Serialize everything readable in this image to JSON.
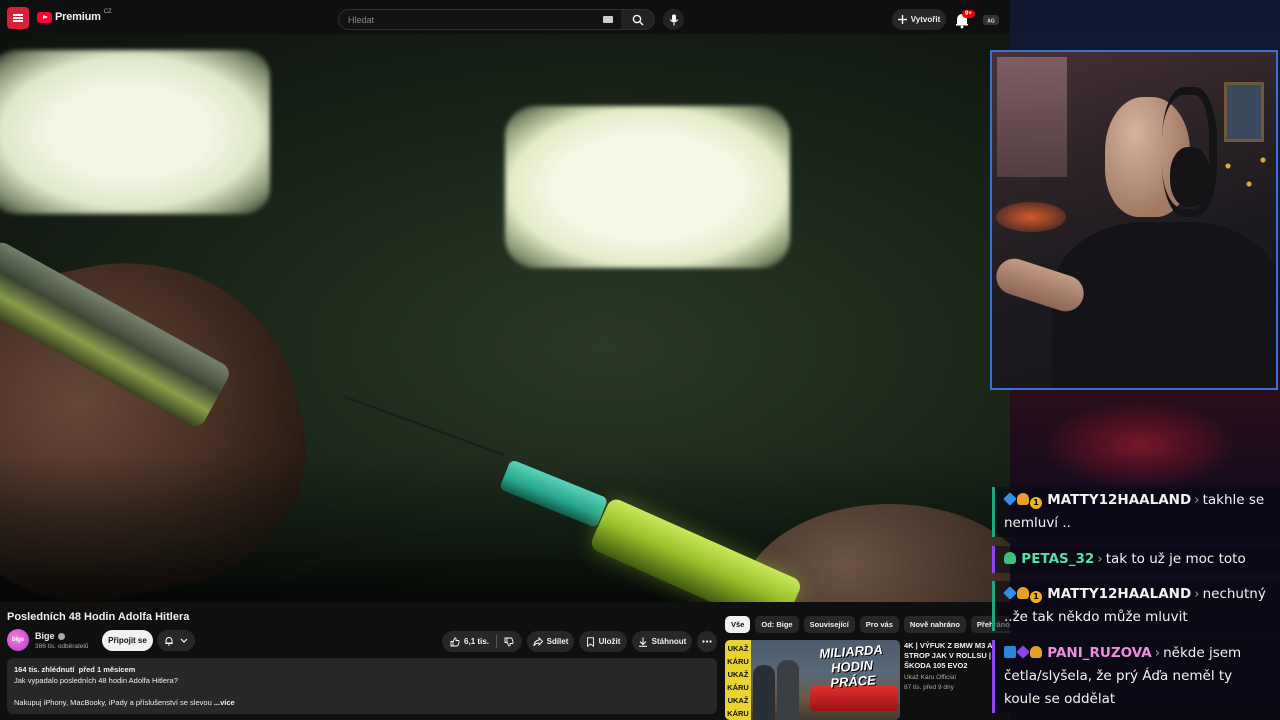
{
  "youtube": {
    "logo_text": "Premium",
    "logo_country": "CZ",
    "search_placeholder": "Hledat",
    "create_label": "Vytvořit",
    "notifications_badge": "9+",
    "video_title": "Posledních 48 Hodin Adolfa Hitlera",
    "channel": {
      "name": "Bige",
      "subscribers": "386 tis. odběratelů",
      "avatar_text": "bige",
      "join_label": "Připojit se"
    },
    "actions": {
      "likes": "6,1 tis.",
      "share": "Sdílet",
      "save": "Uložit",
      "download": "Stáhnout"
    },
    "description": {
      "views": "164 tis. zhlédnutí",
      "time": "před 1 měsícem",
      "line2": "Jak vypadalo posledních 48 hodin Adolfa Hitlera?",
      "line3": "Nakupuj iPhony, MacBooky, iPady a příslušenství se slevou",
      "more": "...více"
    },
    "chips": [
      "Vše",
      "Od: Bige",
      "Související",
      "Pro vás",
      "Nově nahráno",
      "Přehráno"
    ],
    "recommended": {
      "thumb_strip": [
        "UKAŽ",
        "KÁRU",
        "UKAŽ",
        "KÁRU",
        "UKAŽ",
        "KÁRU"
      ],
      "thumb_text": "MILIARDA HODIN PRÁCE",
      "title": "4K | VÝFUK Z BMW M3 A STROP JAK V ROLLSU | ŠKODA 105 EVO2",
      "channel": "Ukaž Káru Official",
      "meta": "87 tis.   před 9 dny"
    }
  },
  "chat": {
    "messages": [
      {
        "user": "MATTY12HAALAND",
        "text": "takhle se nemluví ..",
        "user_color": "#e8e8e8"
      },
      {
        "user": "PETAS_32",
        "text": "tak to už je moc toto",
        "user_color": "#57e0a0"
      },
      {
        "user": "MATTY12HAALAND",
        "text": "nechutný ..že tak někdo může mluvit",
        "user_color": "#e8e8e8"
      },
      {
        "user": "PANI_RUZOVA",
        "text": "někde jsem četla/slyšela, že prý Áďa neměl ty koule se oddělat",
        "user_color": "#ee8ee0"
      }
    ]
  },
  "colors": {
    "yt_bg": "#0f0f0f",
    "chip_bg": "#272727",
    "brand_red": "#ff0033",
    "cam_border": "#3a6fd8",
    "chat_green": "#1ea97c",
    "chat_purple": "#8c44f0"
  }
}
